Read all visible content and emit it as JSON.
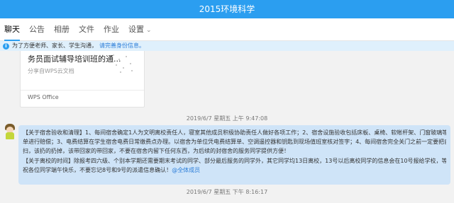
{
  "window": {
    "title": "2015环境科学"
  },
  "tabs": [
    {
      "label": "聊天",
      "active": true
    },
    {
      "label": "公告",
      "active": false
    },
    {
      "label": "相册",
      "active": false
    },
    {
      "label": "文件",
      "active": false
    },
    {
      "label": "作业",
      "active": false
    },
    {
      "label": "设置",
      "active": false
    }
  ],
  "notice": {
    "icon": "info-icon",
    "text": "为了方便老师、家长、学生沟通，",
    "link": "请完善身份信息。"
  },
  "file_card": {
    "title_line1": "务员面试辅导培训班的通...",
    "subtitle": "分享自WPS云文档",
    "source": "WPS Office"
  },
  "timestamps": {
    "first": "2019/6/7 星期五 上午 9:47:08",
    "second": "2019/6/7 星期五 下午 8:16:17"
  },
  "message": {
    "line1": "【关于宿舍验收和清理】1、每间宿舍确定1人为文明离校责任人，寝室其他成员积极协助责任人做好各项工作；2、宿舍设施验收包括床板、桌椅、软帐杆架、门窗玻璃等，物品损坏要按照赔偿清",
    "line2": "单进行赔偿；3、电费结算在学生宿舍电费日常缴费点办理。以宿舍为单位凭电费结算单、空调遥控器和钥匙到现场值班室核对签字；4、每间宿舍完全关门之前一定要把自己的宿舍做全方位的清",
    "line3": "扫，该扔的扔掉，该带回家的带回家，不要在宿舍内留下任何东西，为后续的封宿舍的服务同学提供方便！",
    "line4": "【关于离校的时间】除报考四六级、个别本学期还需要期末考试的同学、部分最后服务的同学外，其它同学均13日离校，13号以后离校同学的信息会在10号报给学校，等待学校的进一步通知。",
    "line5_text": "祝各位同学端午快乐，不要忘记8号和9号的派遣信息确认！",
    "line5_mention": "@全体成员"
  }
}
